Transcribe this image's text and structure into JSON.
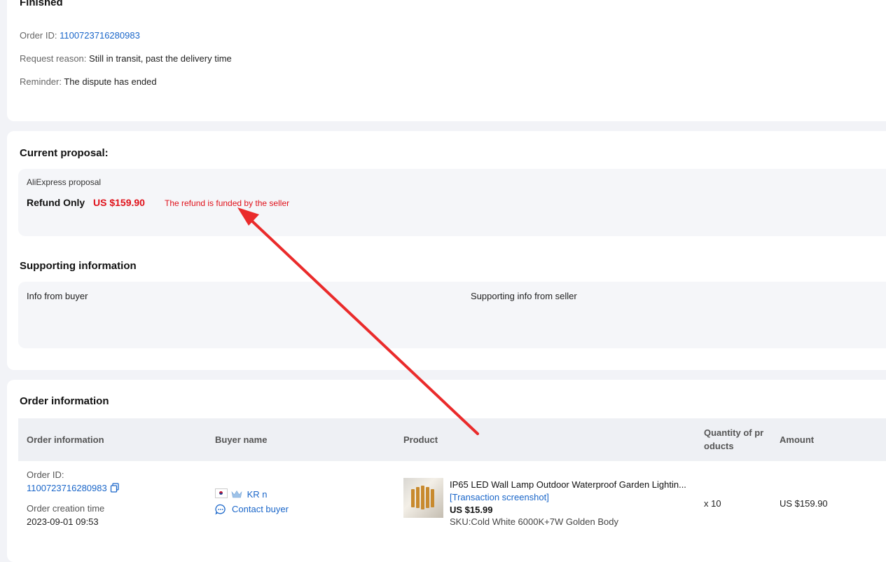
{
  "dispute": {
    "status": "Finished",
    "order_id_label": "Order ID:",
    "order_id": "1100723716280983",
    "request_reason_label": "Request reason:",
    "request_reason": "Still in transit, past the delivery time",
    "reminder_label": "Reminder:",
    "reminder": "The dispute has ended"
  },
  "proposal": {
    "title": "Current proposal:",
    "source": "AliExpress proposal",
    "type": "Refund Only",
    "amount": "US $159.90",
    "note": "The refund is funded by the seller"
  },
  "supporting": {
    "title": "Supporting information",
    "buyer_label": "Info from buyer",
    "seller_label": "Supporting info from seller"
  },
  "order_info": {
    "title": "Order information",
    "columns": [
      "Order information",
      "Buyer name",
      "Product",
      "Quantity of products",
      "Amount"
    ],
    "quantity_header_wrapped": "Quantity of pr oducts",
    "row": {
      "order_id_label": "Order ID:",
      "order_id": "1100723716280983",
      "creation_label": "Order creation time",
      "creation_time": "2023-09-01 09:53",
      "buyer_name": "KR n",
      "contact_label": "Contact buyer",
      "product_title": "IP65 LED Wall Lamp Outdoor Waterproof Garden Lightin...",
      "screenshot_link": "[Transaction screenshot]",
      "price": "US $15.99",
      "sku": "SKU:Cold White 6000K+7W Golden Body",
      "quantity": "x 10",
      "amount": "US $159.90"
    }
  },
  "icons": {
    "copy": "copy-icon",
    "flag": "korea-flag-icon",
    "crown": "crown-icon",
    "chat": "chat-icon"
  },
  "colors": {
    "link": "#1a66c9",
    "accent_red": "#e0111a",
    "annotation_arrow": "#ea2b2b"
  }
}
